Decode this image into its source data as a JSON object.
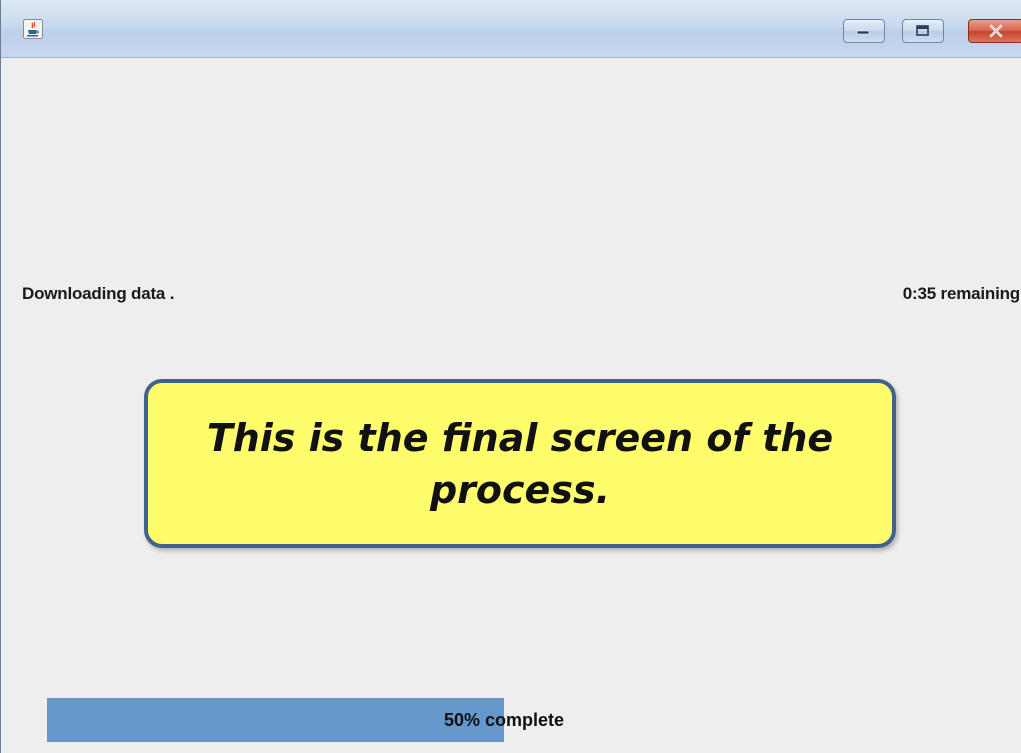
{
  "window": {
    "app_icon": "java-coffee-icon",
    "controls": {
      "minimize_icon": "minimize-icon",
      "maximize_icon": "maximize-icon",
      "close_icon": "close-icon",
      "minimize_glyph": "—",
      "maximize_glyph": "□",
      "close_glyph": "X"
    }
  },
  "status": {
    "task_label": "Downloading data .",
    "time_remaining": "0:35 remaining"
  },
  "callout": {
    "text": "This is the final screen of the process."
  },
  "progress": {
    "percent": 50,
    "label": "50% complete"
  },
  "colors": {
    "progress_fill": "#6698cc",
    "callout_background": "#fffd6b",
    "callout_border": "#41628c",
    "close_button": "#c7432a"
  }
}
